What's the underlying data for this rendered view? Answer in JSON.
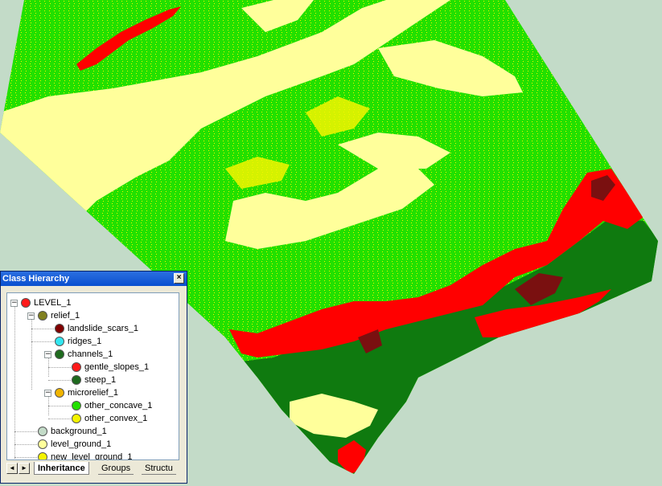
{
  "map": {
    "colors": {
      "background": "#c3dbc8",
      "light_green": "#22e000",
      "pale_yellow": "#ffff9b",
      "yellow": "#f4f400",
      "red": "#ff0000",
      "dark_red": "#7a1010",
      "dark_green": "#0f7a0f"
    }
  },
  "panel": {
    "title": "Class Hierarchy",
    "close_glyph": "×",
    "tree": [
      {
        "label": "LEVEL_1",
        "color": "#ff1a1a",
        "expander": "−"
      },
      {
        "label": "relief_1",
        "color": "#808020",
        "expander": "−"
      },
      {
        "label": "landslide_scars_1",
        "color": "#800000"
      },
      {
        "label": "ridges_1",
        "color": "#33e6f0"
      },
      {
        "label": "channels_1",
        "color": "#1e6a1e",
        "expander": "−"
      },
      {
        "label": "gentle_slopes_1",
        "color": "#ff1a1a"
      },
      {
        "label": "steep_1",
        "color": "#1e6a1e"
      },
      {
        "label": "microrelief_1",
        "color": "#f0b400",
        "expander": "−"
      },
      {
        "label": "other_concave_1",
        "color": "#22e000"
      },
      {
        "label": "other_convex_1",
        "color": "#f4f400"
      },
      {
        "label": "background_1",
        "color": "#c3dbc8"
      },
      {
        "label": "level_ground_1",
        "color": "#ffff9b"
      },
      {
        "label": "new_level_ground_1",
        "color": "#f4f400"
      }
    ],
    "tabs": {
      "scroll_left": "◄",
      "scroll_right": "►",
      "inheritance": "Inheritance",
      "groups": "Groups",
      "structure": "Structu"
    }
  }
}
